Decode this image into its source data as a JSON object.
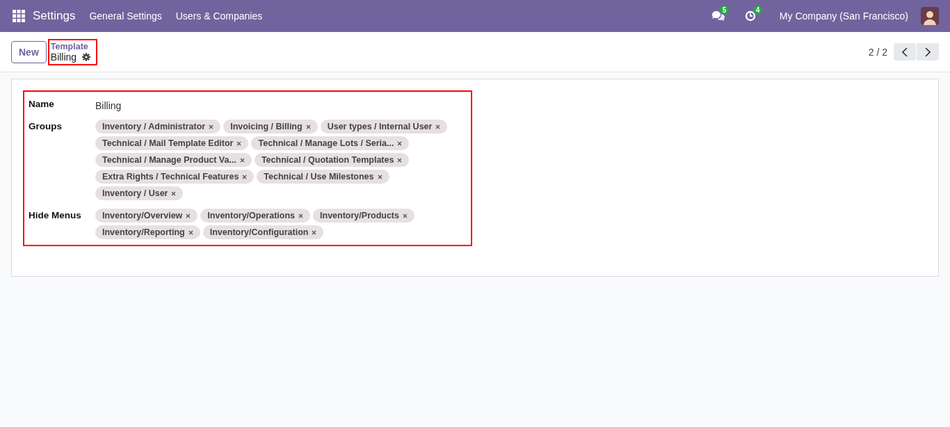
{
  "navbar": {
    "app_title": "Settings",
    "menu": [
      "General Settings",
      "Users & Companies"
    ],
    "messages_count": "5",
    "activities_count": "4",
    "company": "My Company (San Francisco)"
  },
  "control_panel": {
    "new_button": "New",
    "breadcrumb": "Template",
    "record_title": "Billing",
    "pager": "2 / 2"
  },
  "form": {
    "fields": [
      {
        "label": "Name",
        "kind": "text",
        "value": "Billing"
      },
      {
        "label": "Groups",
        "kind": "tags",
        "tags": [
          "Inventory / Administrator",
          "Invoicing / Billing",
          "User types / Internal User",
          "Technical / Mail Template Editor",
          "Technical / Manage Lots / Seria...",
          "Technical / Manage Product Va...",
          "Technical / Quotation Templates",
          "Extra Rights / Technical Features",
          "Technical / Use Milestones",
          "Inventory / User"
        ]
      },
      {
        "label": "Hide Menus",
        "kind": "tags",
        "tags": [
          "Inventory/Overview",
          "Inventory/Operations",
          "Inventory/Products",
          "Inventory/Reporting",
          "Inventory/Configuration"
        ]
      }
    ]
  }
}
